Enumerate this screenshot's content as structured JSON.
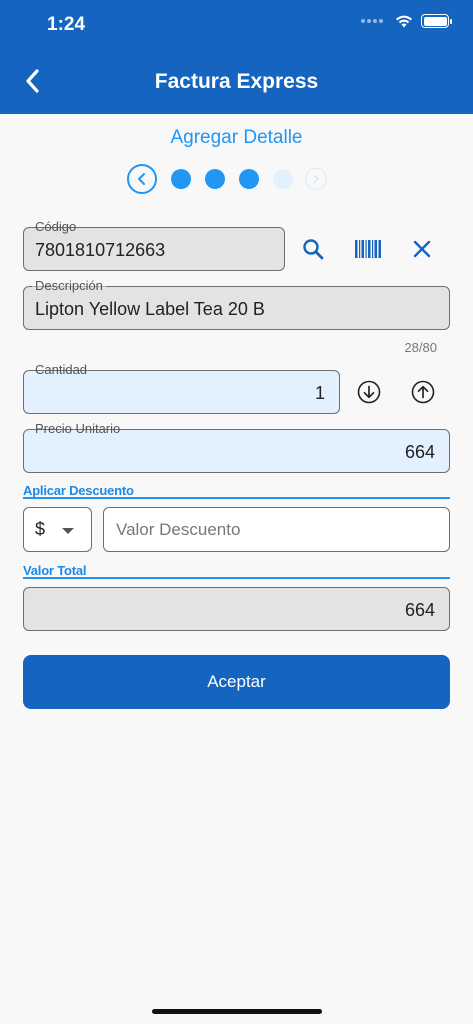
{
  "status": {
    "time": "1:24"
  },
  "header": {
    "title": "Factura Express",
    "back_icon": "chevron-left-icon"
  },
  "step": {
    "title": "Agregar Detalle",
    "dots": [
      "active",
      "active",
      "active",
      "inactive"
    ]
  },
  "form": {
    "codigo": {
      "label": "Código",
      "value": "7801810712663"
    },
    "descripcion": {
      "label": "Descripción",
      "value": "Lipton Yellow Label Tea 20 B",
      "counter": "28/80"
    },
    "cantidad": {
      "label": "Cantidad",
      "value": "1"
    },
    "precio": {
      "label": "Precio Unitario",
      "value": "664"
    },
    "descuento": {
      "section_label": "Aplicar Descuento",
      "currency": "$",
      "placeholder": "Valor Descuento"
    },
    "total": {
      "section_label": "Valor Total",
      "value": "664"
    }
  },
  "actions": {
    "accept_label": "Aceptar"
  },
  "colors": {
    "primary": "#1565c0",
    "accent": "#2196f3",
    "readonly": "#e3e3e3",
    "editable": "#e3f0fd"
  }
}
